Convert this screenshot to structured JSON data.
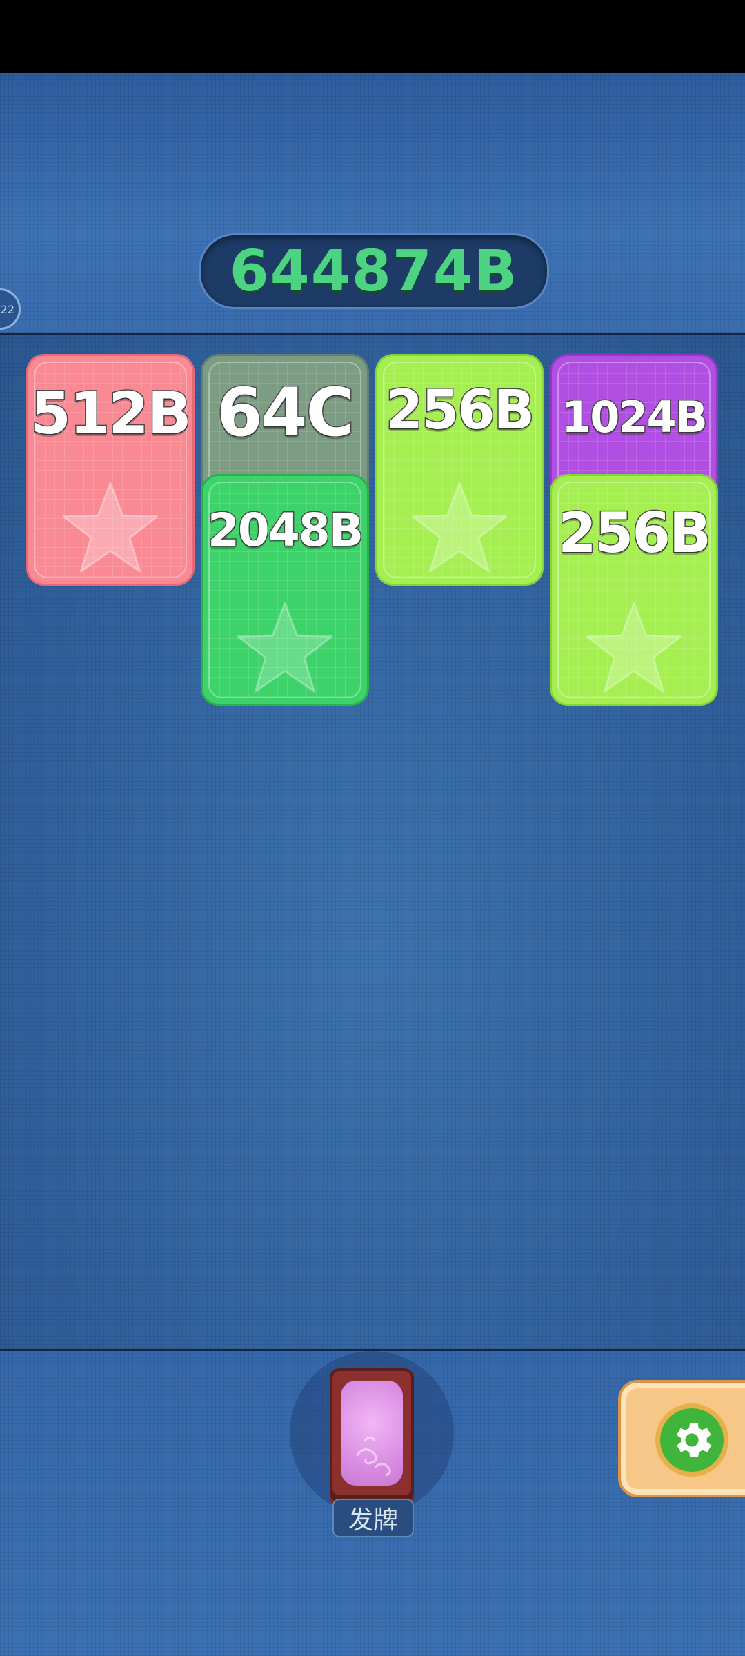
{
  "header": {
    "score": "644874B",
    "side_badge": "22"
  },
  "columns": [
    {
      "cards": [
        {
          "label": "512B",
          "color": "pink"
        }
      ]
    },
    {
      "cards": [
        {
          "label": "64C",
          "color": "gray"
        },
        {
          "label": "2048B",
          "color": "green"
        }
      ]
    },
    {
      "cards": [
        {
          "label": "256B",
          "color": "lime"
        }
      ]
    },
    {
      "cards": [
        {
          "label": "1024B",
          "color": "purple"
        },
        {
          "label": "256B",
          "color": "lime"
        }
      ]
    }
  ],
  "colors": {
    "pink": "#f98a94",
    "gray": "#7c9d83",
    "green": "#3ed36a",
    "lime": "#a5ef52",
    "purple": "#b24fe3",
    "score": "#4dd483",
    "settings_button": "#f7c788"
  },
  "footer": {
    "deal_label": "发牌",
    "settings_icon": "gear-icon",
    "deck_icon": "card-deck-icon"
  }
}
